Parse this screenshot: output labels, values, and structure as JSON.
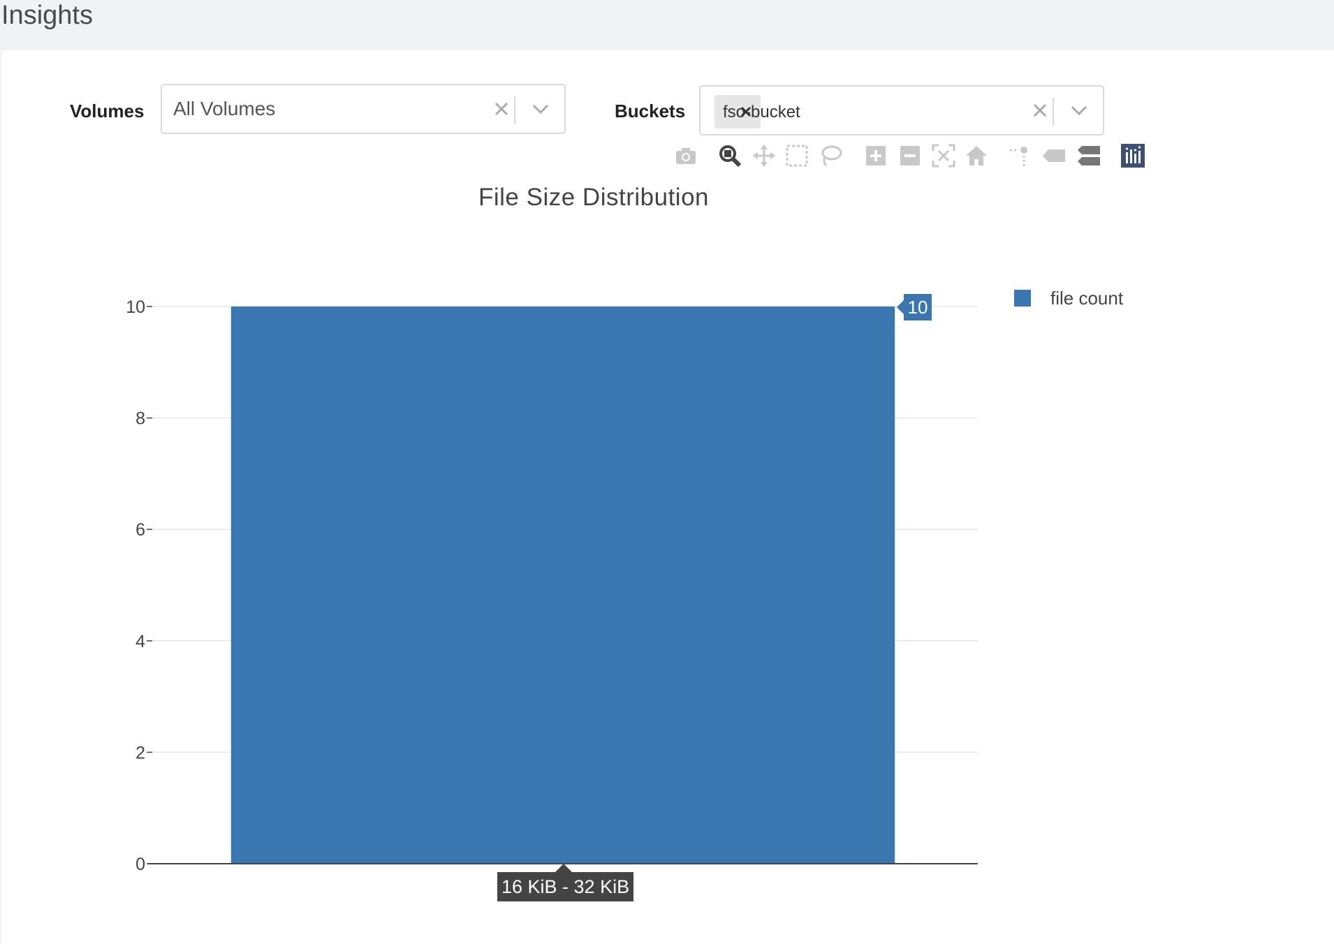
{
  "header": {
    "title": "Insights"
  },
  "filters": {
    "volumes": {
      "label": "Volumes",
      "value": "All Volumes"
    },
    "buckets": {
      "label": "Buckets",
      "selected_tags": [
        "fso-bucket"
      ]
    }
  },
  "modebar": {
    "icons": [
      "camera-icon",
      "zoom-icon",
      "pan-icon",
      "box-select-icon",
      "lasso-select-icon",
      "zoom-in-icon",
      "zoom-out-icon",
      "autoscale-icon",
      "reset-axes-icon",
      "spike-lines-icon",
      "hover-closest-icon",
      "hover-compare-icon",
      "plotly-logo-icon"
    ]
  },
  "chart_data": {
    "type": "bar",
    "title": "File Size Distribution",
    "categories": [
      "16 KiB - 32 KiB"
    ],
    "series": [
      {
        "name": "file count",
        "values": [
          10
        ],
        "color": "#3a76b0"
      }
    ],
    "ylim": [
      0,
      10
    ],
    "yticks": [
      0,
      2,
      4,
      6,
      8,
      10
    ],
    "grid": true,
    "legend_position": "top-right",
    "hover": {
      "value_label": "10",
      "category_label": "16 KiB - 32 KiB"
    }
  }
}
